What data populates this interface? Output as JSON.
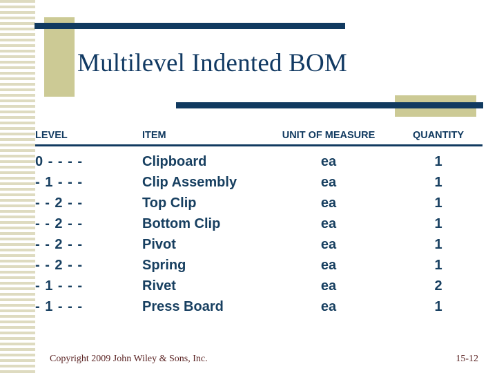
{
  "slide": {
    "title": "Multilevel Indented BOM",
    "colors": {
      "navy": "#113a60",
      "beige": "#ccca95",
      "stripe": "#dedbc0",
      "title_text": "#123a63",
      "footer_text": "#5a2323",
      "background": "#ffffff"
    }
  },
  "table": {
    "headers": {
      "level": "LEVEL",
      "item": "ITEM",
      "uom": "UNIT OF MEASURE",
      "quantity": "QUANTITY"
    },
    "rows": [
      {
        "level": "0 - - - -",
        "item": "Clipboard",
        "uom": "ea",
        "quantity": "1"
      },
      {
        "level": "- 1 - - -",
        "item": "Clip Assembly",
        "uom": "ea",
        "quantity": "1"
      },
      {
        "level": "- - 2 - -",
        "item": "Top Clip",
        "uom": "ea",
        "quantity": "1"
      },
      {
        "level": "- - 2 - -",
        "item": "Bottom Clip",
        "uom": "ea",
        "quantity": "1"
      },
      {
        "level": "- - 2 - -",
        "item": "Pivot",
        "uom": "ea",
        "quantity": "1"
      },
      {
        "level": "- - 2 - -",
        "item": "Spring",
        "uom": "ea",
        "quantity": "1"
      },
      {
        "level": "- 1 - - -",
        "item": "Rivet",
        "uom": "ea",
        "quantity": "2"
      },
      {
        "level": "- 1 - - -",
        "item": "Press Board",
        "uom": "ea",
        "quantity": "1"
      }
    ]
  },
  "footer": {
    "copyright": "Copyright 2009 John Wiley & Sons, Inc.",
    "slide_number": "15-12"
  }
}
